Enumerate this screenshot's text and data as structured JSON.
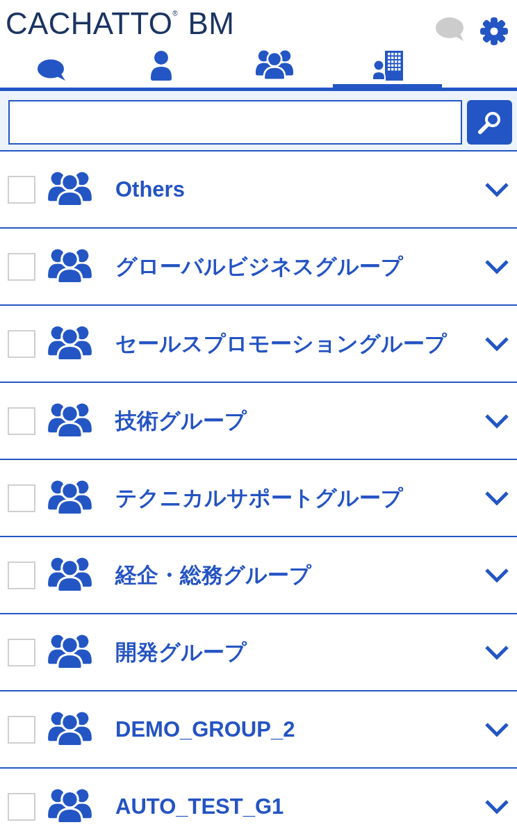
{
  "header": {
    "logo": "CACHATTO$^{®}$ BM"
  },
  "tabs": [
    {
      "kind": "chat",
      "selected": false
    },
    {
      "kind": "person",
      "selected": false
    },
    {
      "kind": "group",
      "selected": false
    },
    {
      "kind": "organization",
      "selected": true
    }
  ],
  "groups": [
    {
      "name": "Others",
      "checked": false,
      "expanded": false
    },
    {
      "name": "グローバルビジネスグループ",
      "checked": false,
      "expanded": false
    },
    {
      "name": "セールスプロモーショングループ",
      "checked": false,
      "expanded": false
    },
    {
      "name": "技術グループ",
      "checked": false,
      "expanded": false
    },
    {
      "name": "テクニカルサポートグループ",
      "checked": false,
      "expanded": false
    },
    {
      "name": "経企・総務グループ",
      "checked": false,
      "expanded": false
    },
    {
      "name": "開発グループ",
      "checked": false,
      "expanded": false
    },
    {
      "name": "DEMO_GROUP_2",
      "checked": false,
      "expanded": false
    },
    {
      "name": "AUTO_TEST_G1",
      "checked": false,
      "expanded": false
    }
  ]
}
